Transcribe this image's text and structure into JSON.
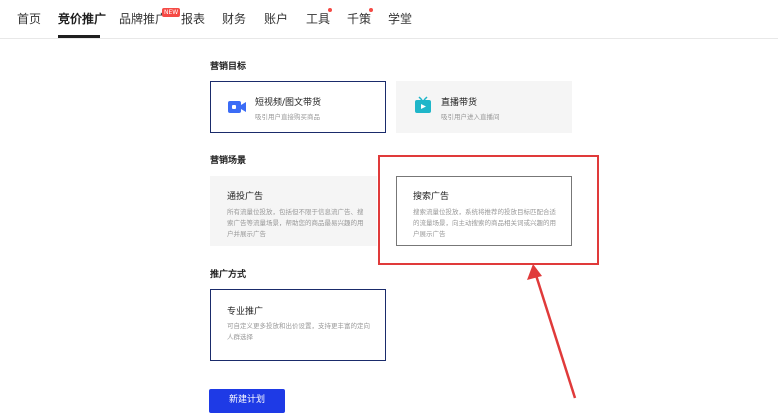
{
  "nav": {
    "items": [
      "首页",
      "竞价推广",
      "品牌推广",
      "报表",
      "财务",
      "账户",
      "工具",
      "千策",
      "学堂"
    ],
    "new_badge": "NEW"
  },
  "goal": {
    "title": "营销目标",
    "cards": [
      {
        "title": "短视频/图文带货",
        "desc": "吸引用户直接购买商品"
      },
      {
        "title": "直播带货",
        "desc": "吸引用户进入直播间"
      }
    ]
  },
  "scene": {
    "title": "营销场景",
    "cards": [
      {
        "title": "通投广告",
        "desc": "所有流量位投放，包括但不限于信息流广告、搜索广告等流量场景，帮助您的商品最易兴趣的用户并展示广告"
      },
      {
        "title": "搜索广告",
        "desc": "搜索流量位投放，系统将推荐的投放目标匹配合适的流量场景，向主动搜索的商品相关词或兴趣的用户展示广告"
      }
    ]
  },
  "method": {
    "title": "推广方式",
    "cards": [
      {
        "title": "专业推广",
        "desc": "可自定义更多投放和出价设置，支持更丰富的定向人群选择"
      }
    ]
  },
  "create_button": "新建计划",
  "colors": {
    "accent": "#1e3ae6",
    "highlight": "#e03a3a",
    "badge": "#f54a45"
  }
}
